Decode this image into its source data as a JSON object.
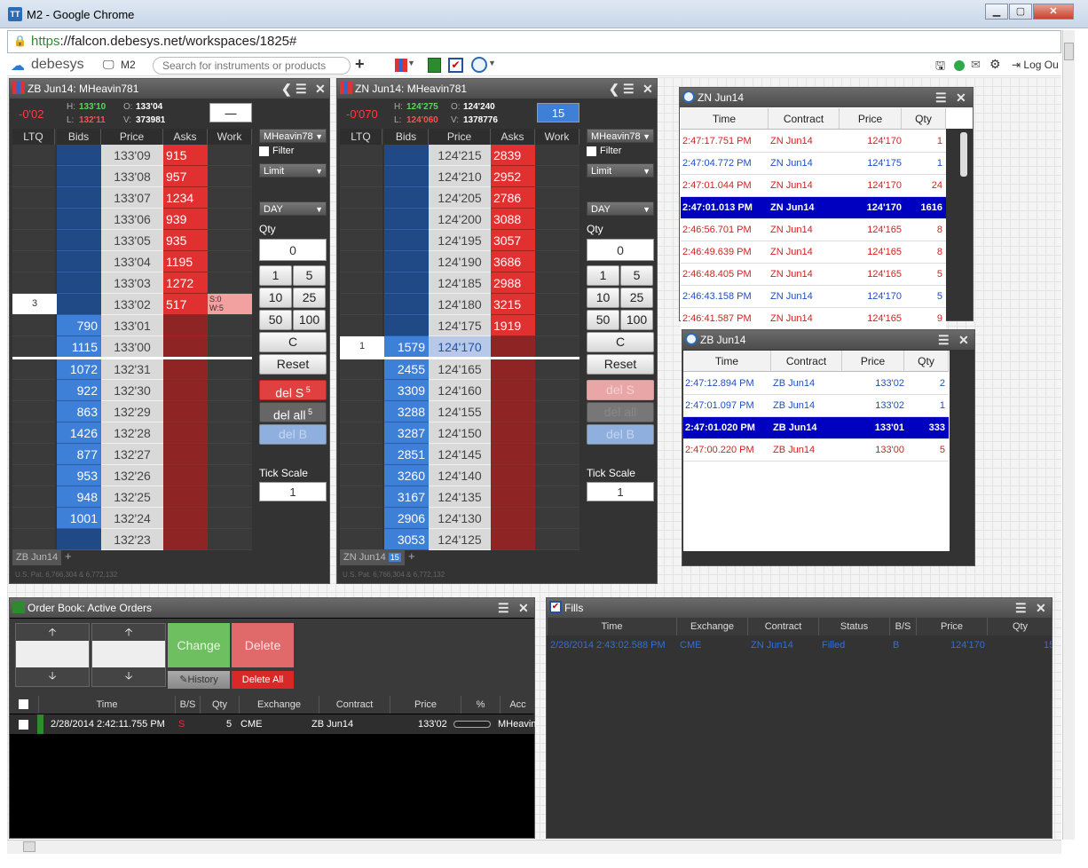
{
  "window": {
    "title": "M2 - Google Chrome",
    "app_icon": "TT"
  },
  "address": {
    "scheme": "https",
    "host_path": "://falcon.debesys.net/workspaces/1825#"
  },
  "appbar": {
    "brand": "debesys",
    "workspace": "M2",
    "search_placeholder": "Search for instruments or products",
    "logout": "Log Ou"
  },
  "ladder_zb": {
    "title": "ZB Jun14: MHeavin781",
    "change": "-0'02",
    "high": "133'10",
    "low": "132'11",
    "open": "133'04",
    "volume": "373981",
    "qty_box": "—",
    "headers": [
      "LTQ",
      "Bids",
      "Price",
      "Asks",
      "Work"
    ],
    "prices": [
      "133'09",
      "133'08",
      "133'07",
      "133'06",
      "133'05",
      "133'04",
      "133'03",
      "133'02",
      "133'01",
      "133'00",
      "132'31",
      "132'30",
      "132'29",
      "132'28",
      "132'27",
      "132'26",
      "132'25",
      "132'24",
      "132'23"
    ],
    "asks": [
      "915",
      "957",
      "1234",
      "939",
      "935",
      "1195",
      "1272",
      "517",
      "",
      "",
      "",
      "",
      "",
      "",
      "",
      "",
      "",
      "",
      ""
    ],
    "bids": [
      "",
      "",
      "",
      "",
      "",
      "",
      "",
      "",
      "790",
      "1115",
      "1072",
      "922",
      "863",
      "1426",
      "877",
      "953",
      "948",
      "1001",
      ""
    ],
    "ltq_value": "3",
    "work_s": "S:0",
    "work_w": "W:5",
    "account": "MHeavin78",
    "filter": "Filter",
    "order_type": "Limit",
    "tif": "DAY",
    "qty_label": "Qty",
    "qty_value": "0",
    "qty_buttons": [
      "1",
      "5",
      "10",
      "25",
      "50",
      "100"
    ],
    "clear": "C",
    "reset": "Reset",
    "del_s": "del S",
    "del_s_count": "5",
    "del_all": "del all",
    "del_all_count": "5",
    "del_b": "del B",
    "tick_scale_label": "Tick Scale",
    "tick_scale": "1",
    "tab": "ZB Jun14",
    "patent": "U.S. Pat. 6,766,304 & 6,772,132"
  },
  "ladder_zn": {
    "title": "ZN Jun14: MHeavin781",
    "change": "-0'070",
    "high": "124'275",
    "low": "124'060",
    "open": "124'240",
    "volume": "1378776",
    "qty_box": "15",
    "headers": [
      "LTQ",
      "Bids",
      "Price",
      "Asks",
      "Work"
    ],
    "prices": [
      "124'215",
      "124'210",
      "124'205",
      "124'200",
      "124'195",
      "124'190",
      "124'185",
      "124'180",
      "124'175",
      "124'170",
      "124'165",
      "124'160",
      "124'155",
      "124'150",
      "124'145",
      "124'140",
      "124'135",
      "124'130",
      "124'125"
    ],
    "asks": [
      "2839",
      "2952",
      "2786",
      "3088",
      "3057",
      "3686",
      "2988",
      "3215",
      "1919",
      "",
      "",
      "",
      "",
      "",
      "",
      "",
      "",
      "",
      ""
    ],
    "bids": [
      "",
      "",
      "",
      "",
      "",
      "",
      "",
      "",
      "",
      "1579",
      "2455",
      "3309",
      "3288",
      "3287",
      "2851",
      "3260",
      "3167",
      "2906",
      "3053"
    ],
    "ltq_value": "1",
    "account": "MHeavin78",
    "filter": "Filter",
    "order_type": "Limit",
    "tif": "DAY",
    "qty_label": "Qty",
    "qty_value": "0",
    "qty_buttons": [
      "1",
      "5",
      "10",
      "25",
      "50",
      "100"
    ],
    "clear": "C",
    "reset": "Reset",
    "del_s": "del S",
    "del_all": "del all",
    "del_b": "del B",
    "tick_scale_label": "Tick Scale",
    "tick_scale": "1",
    "tab": "ZN Jun14",
    "tab_badge": "15",
    "patent": "U.S. Pat. 6,766,304 & 6,772,132"
  },
  "ts_zn": {
    "title": "ZN Jun14",
    "headers": [
      "Time",
      "Contract",
      "Price",
      "Qty"
    ],
    "rows": [
      {
        "time": "2:47:17.751 PM",
        "contract": "ZN Jun14",
        "price": "124'170",
        "qty": "1",
        "color": "#d42020"
      },
      {
        "time": "2:47:04.772 PM",
        "contract": "ZN Jun14",
        "price": "124'175",
        "qty": "1",
        "color": "#1f4fbf"
      },
      {
        "time": "2:47:01.044 PM",
        "contract": "ZN Jun14",
        "price": "124'170",
        "qty": "24",
        "color": "#d42020"
      },
      {
        "time": "2:47:01.013 PM",
        "contract": "ZN Jun14",
        "price": "124'170",
        "qty": "1616",
        "color": "#fff",
        "hl": true
      },
      {
        "time": "2:46:56.701 PM",
        "contract": "ZN Jun14",
        "price": "124'165",
        "qty": "8",
        "color": "#d42020"
      },
      {
        "time": "2:46:49.639 PM",
        "contract": "ZN Jun14",
        "price": "124'165",
        "qty": "8",
        "color": "#d42020"
      },
      {
        "time": "2:46:48.405 PM",
        "contract": "ZN Jun14",
        "price": "124'165",
        "qty": "5",
        "color": "#d42020"
      },
      {
        "time": "2:46:43.158 PM",
        "contract": "ZN Jun14",
        "price": "124'170",
        "qty": "5",
        "color": "#1f4fbf"
      },
      {
        "time": "2:46:41.587 PM",
        "contract": "ZN Jun14",
        "price": "124'165",
        "qty": "9",
        "color": "#d42020"
      }
    ]
  },
  "ts_zb": {
    "title": "ZB Jun14",
    "headers": [
      "Time",
      "Contract",
      "Price",
      "Qty"
    ],
    "rows": [
      {
        "time": "2:47:12.894 PM",
        "contract": "ZB Jun14",
        "price": "133'02",
        "qty": "2",
        "color": "#1f4fbf"
      },
      {
        "time": "2:47:01.097 PM",
        "contract": "ZB Jun14",
        "price": "133'02",
        "qty": "1",
        "color": "#1f4fbf"
      },
      {
        "time": "2:47:01.020 PM",
        "contract": "ZB Jun14",
        "price": "133'01",
        "qty": "333",
        "color": "#fff",
        "hl": true
      },
      {
        "time": "2:47:00.220 PM",
        "contract": "ZB Jun14",
        "price": "133'00",
        "qty": "5",
        "color": "#d42020"
      }
    ]
  },
  "order_book": {
    "title": "Order Book: Active Orders",
    "change": "Change",
    "delete": "Delete",
    "history": "History",
    "delete_all": "Delete All",
    "headers": [
      "Time",
      "B/S",
      "Qty",
      "Exchange",
      "Contract",
      "Price",
      "%",
      "Acc"
    ],
    "row": {
      "time": "2/28/2014 2:42:11.755 PM",
      "bs": "S",
      "qty": "5",
      "exchange": "CME",
      "contract": "ZB Jun14",
      "price": "133'02",
      "account": "MHeavin"
    }
  },
  "fills": {
    "title": "Fills",
    "headers": [
      "Time",
      "Exchange",
      "Contract",
      "Status",
      "B/S",
      "Price",
      "Qty"
    ],
    "row": {
      "time": "2/28/2014 2:43:02.588 PM",
      "exchange": "CME",
      "contract": "ZN Jun14",
      "status": "Filled",
      "bs": "B",
      "price": "124'170",
      "qty": "15"
    }
  },
  "colors": {
    "ask": "#e03030",
    "bid": "#3e7fd8",
    "highlight": "#0000c0",
    "change": "#ff3b3b"
  }
}
